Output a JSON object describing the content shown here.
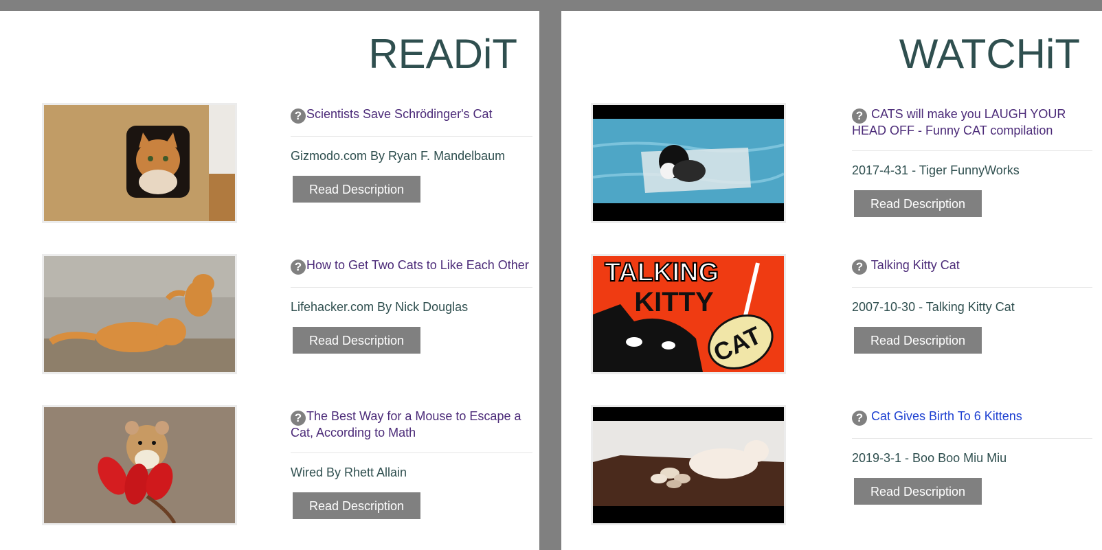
{
  "read": {
    "title": "READiT",
    "help_glyph": "?",
    "button_label": "Read Description",
    "items": [
      {
        "title": "Scientists Save Schrödinger's Cat",
        "meta": "Gizmodo.com By Ryan F. Mandelbaum"
      },
      {
        "title": "How to Get Two Cats to Like Each Other",
        "meta": "Lifehacker.com By Nick Douglas"
      },
      {
        "title": "The Best Way for a Mouse to Escape a Cat, According to Math",
        "meta": "Wired By Rhett Allain"
      }
    ]
  },
  "watch": {
    "title": "WATCHiT",
    "help_glyph": "?",
    "button_label": "Read Description",
    "items": [
      {
        "title": "CATS will make you LAUGH YOUR HEAD OFF - Funny CAT compilation",
        "meta": "2017-4-31 - Tiger FunnyWorks"
      },
      {
        "title": "Talking Kitty Cat",
        "meta": "2007-10-30 - Talking Kitty Cat",
        "thumb_text_1": "TALKING",
        "thumb_text_2": "KITTY",
        "thumb_text_3": "CAT"
      },
      {
        "title": "Cat Gives Birth To 6 Kittens",
        "meta": "2019-3-1 - Boo Boo Miu Miu"
      }
    ]
  },
  "colors": {
    "background": "#808080",
    "heading": "#2f4f4f",
    "link": "#4b2a78",
    "link_active": "#1c3fd1",
    "button": "#808080"
  }
}
